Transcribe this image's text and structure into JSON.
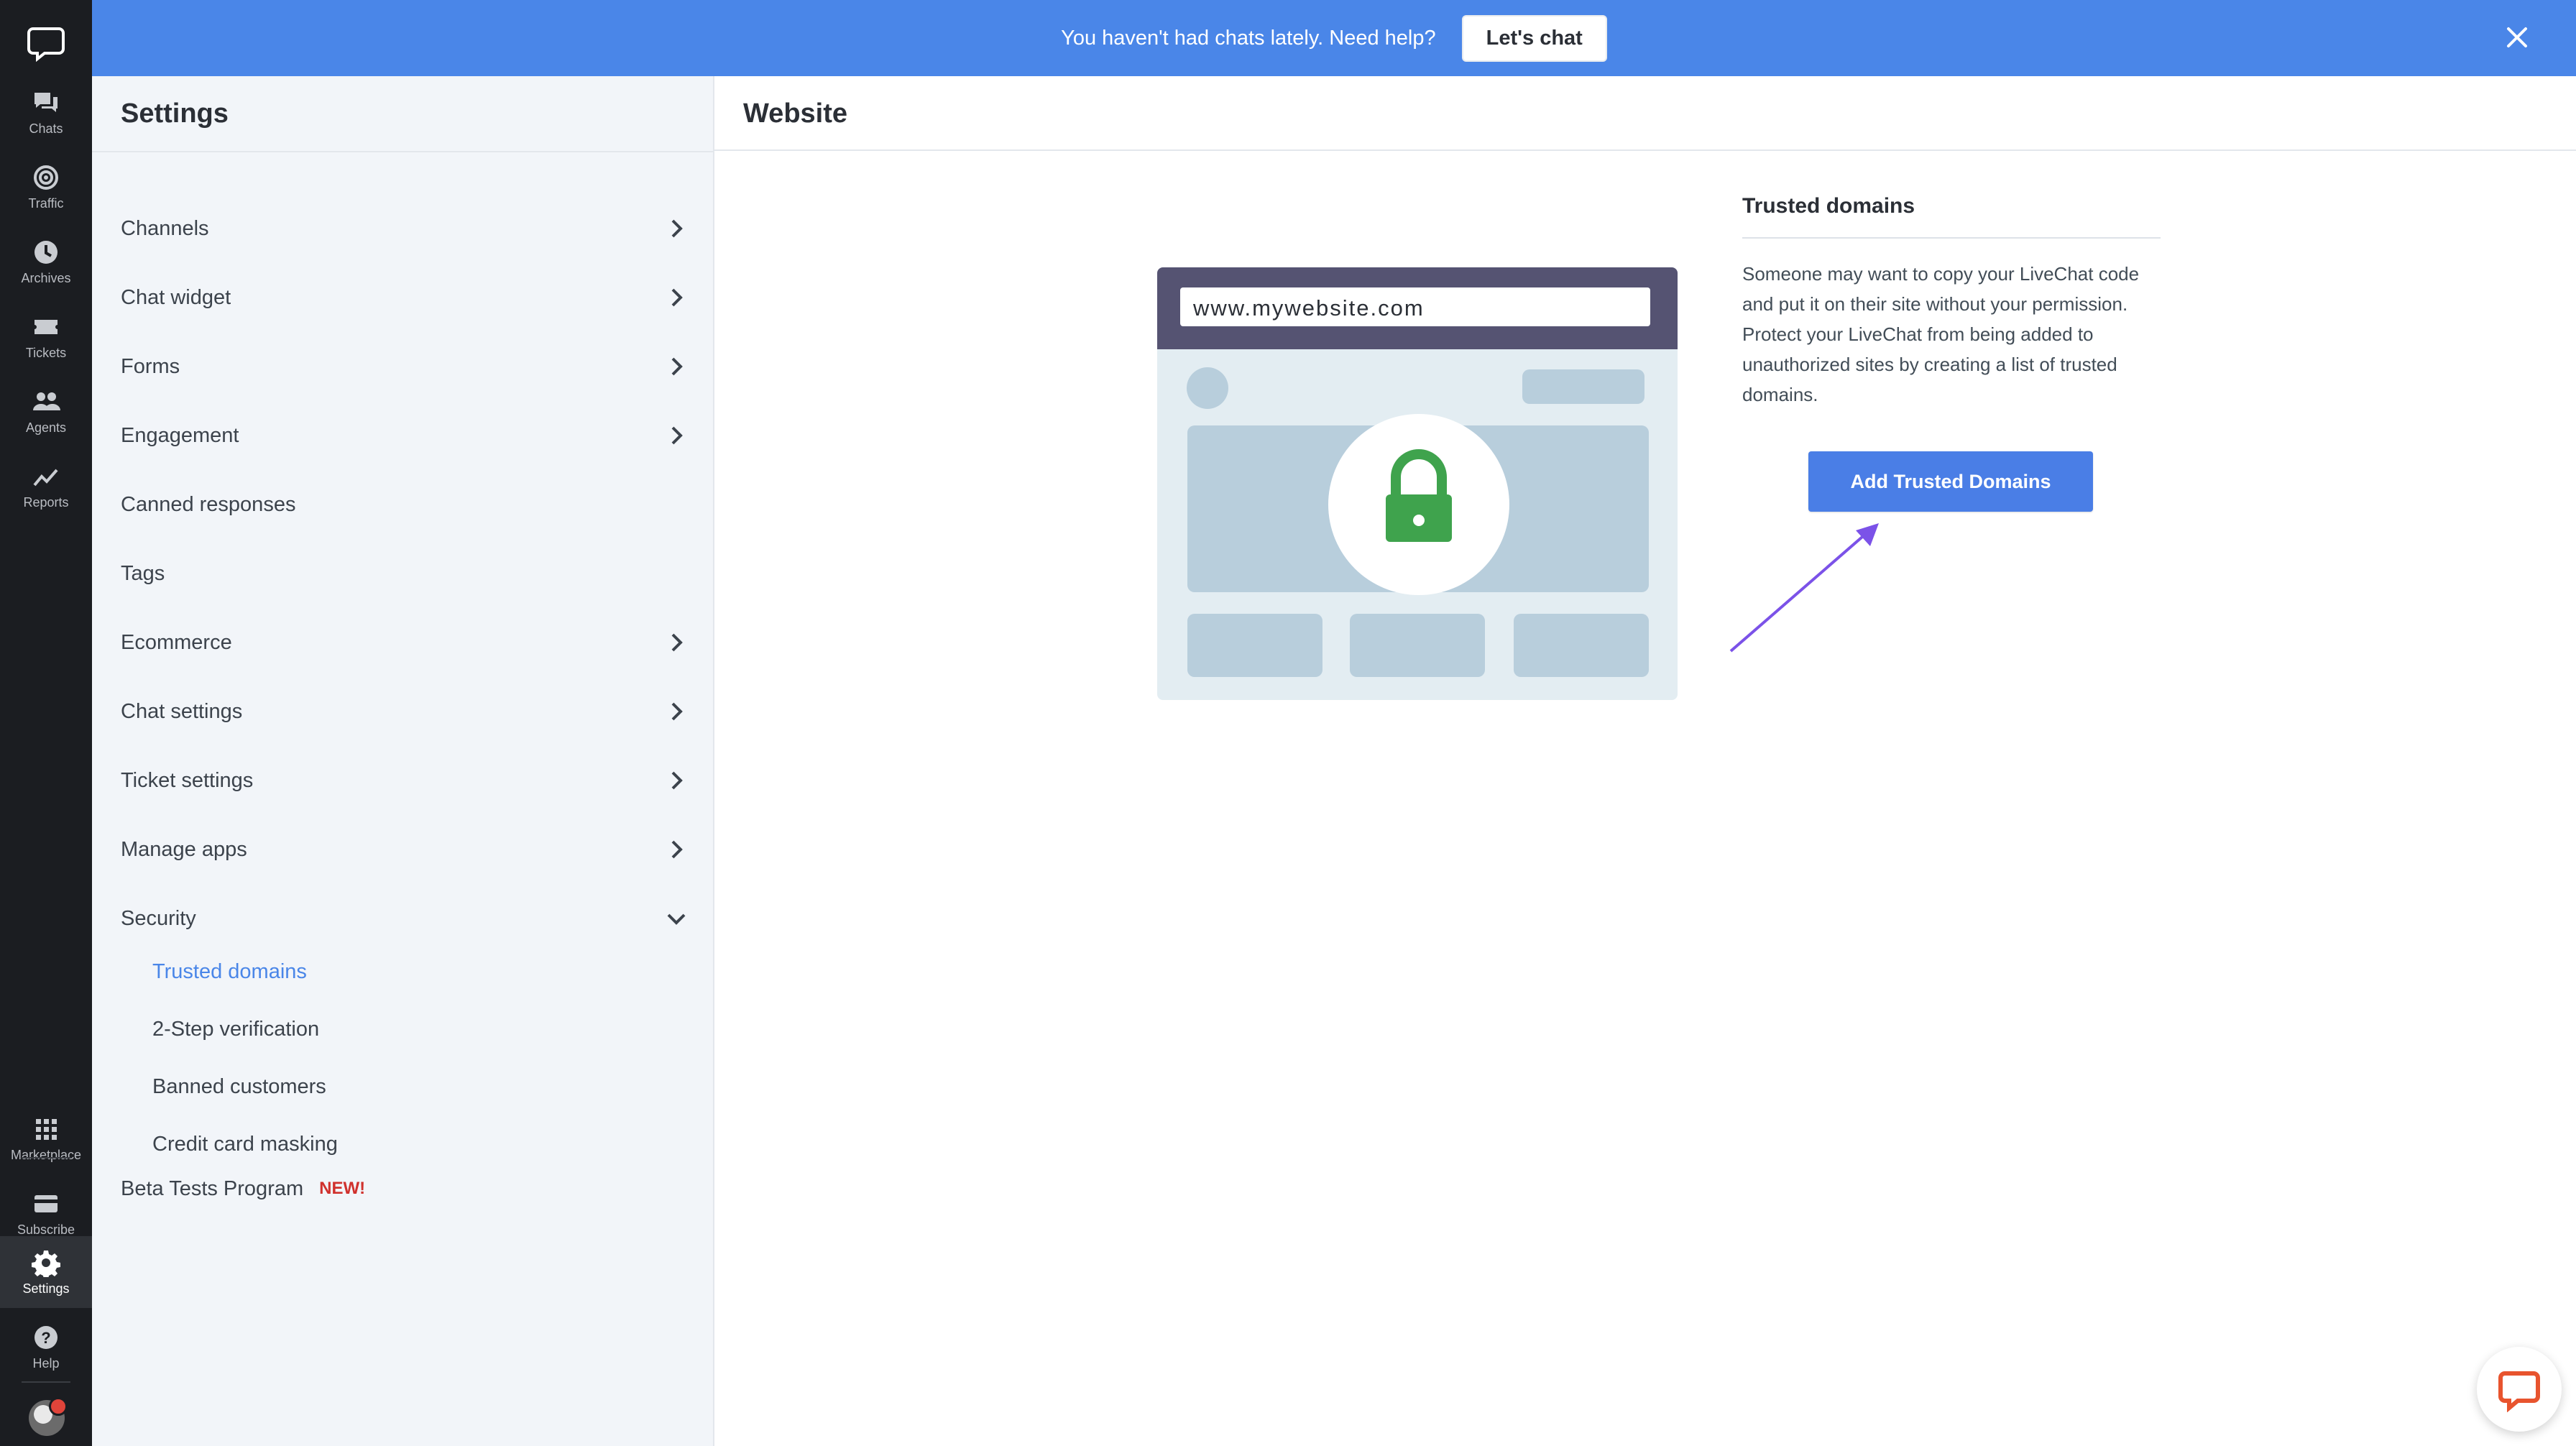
{
  "banner": {
    "text": "You haven't had chats lately. Need help?",
    "button_label": "Let's chat",
    "close_icon": "close-icon",
    "color": "#4a86e8"
  },
  "rail": {
    "items": [
      {
        "label": "Chats",
        "icon": "chats-icon"
      },
      {
        "label": "Traffic",
        "icon": "traffic-icon"
      },
      {
        "label": "Archives",
        "icon": "archives-icon"
      },
      {
        "label": "Tickets",
        "icon": "tickets-icon"
      },
      {
        "label": "Agents",
        "icon": "agents-icon"
      },
      {
        "label": "Reports",
        "icon": "reports-icon"
      }
    ],
    "bottom_items": [
      {
        "label": "Marketplace",
        "icon": "marketplace-icon"
      },
      {
        "label": "Subscribe",
        "icon": "subscribe-icon"
      },
      {
        "label": "Settings",
        "icon": "settings-icon",
        "active": true
      },
      {
        "label": "Help",
        "icon": "help-icon"
      }
    ]
  },
  "settings": {
    "title": "Settings",
    "menu": [
      {
        "label": "Channels",
        "chevron": "right"
      },
      {
        "label": "Chat widget",
        "chevron": "right"
      },
      {
        "label": "Forms",
        "chevron": "right"
      },
      {
        "label": "Engagement",
        "chevron": "right"
      },
      {
        "label": "Canned responses",
        "chevron": "none"
      },
      {
        "label": "Tags",
        "chevron": "none"
      },
      {
        "label": "Ecommerce",
        "chevron": "right"
      },
      {
        "label": "Chat settings",
        "chevron": "right"
      },
      {
        "label": "Ticket settings",
        "chevron": "right"
      },
      {
        "label": "Manage apps",
        "chevron": "right"
      },
      {
        "label": "Security",
        "chevron": "down"
      }
    ],
    "security_sub": [
      {
        "label": "Trusted domains",
        "active": true
      },
      {
        "label": "2-Step verification"
      },
      {
        "label": "Banned customers"
      },
      {
        "label": "Credit card masking"
      }
    ],
    "beta": {
      "label": "Beta Tests Program",
      "badge": "NEW!"
    }
  },
  "main": {
    "title": "Website",
    "illustration_url": "www.mywebsite.com",
    "trusted_domains": {
      "title": "Trusted domains",
      "description": "Someone may want to copy your LiveChat code and put it on their site without your permission. Protect your LiveChat from being added to unauthorized sites by creating a list of trusted domains.",
      "button_label": "Add Trusted Domains",
      "button_color": "#4a7ee6"
    }
  },
  "accent_arrow_color": "#7b52e8"
}
